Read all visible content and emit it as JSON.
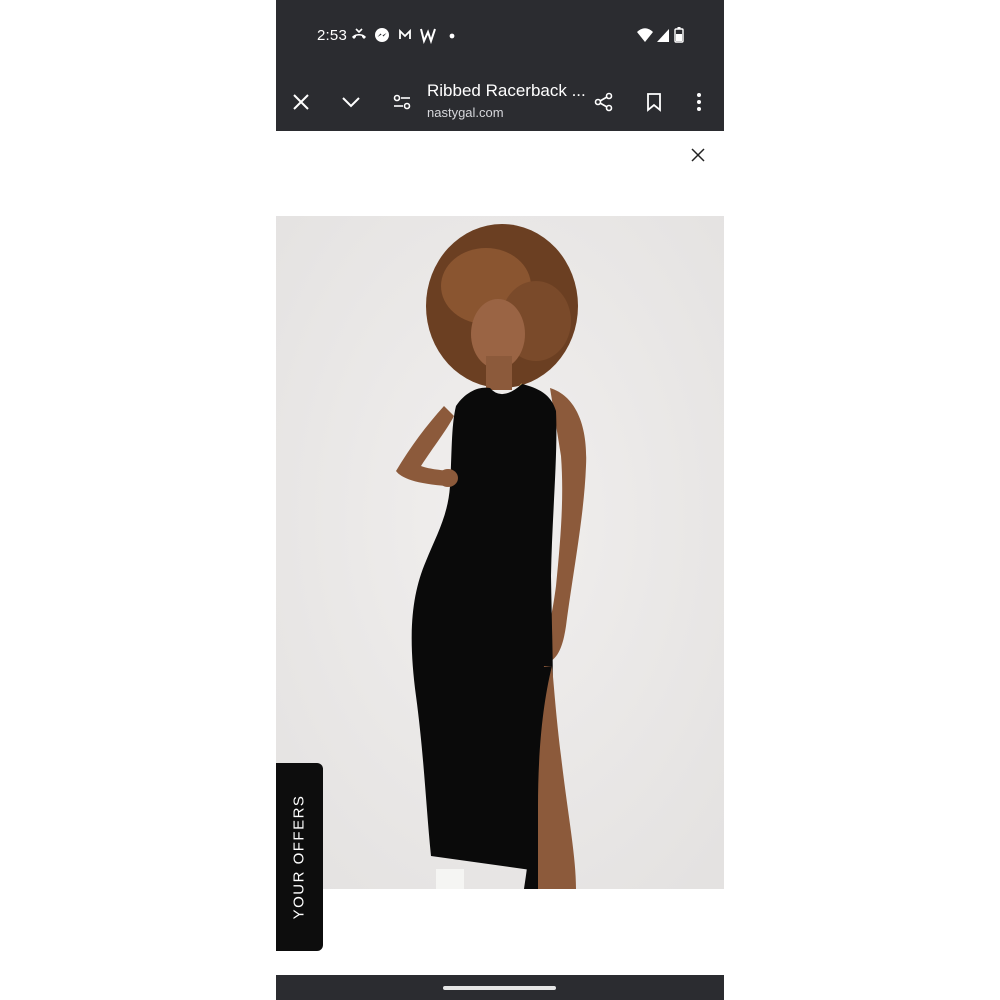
{
  "status_bar": {
    "time": "2:53",
    "icons": [
      "missed-call-icon",
      "messenger-icon",
      "gmail-icon",
      "w-app-icon",
      "dot-icon",
      "wifi-icon",
      "signal-icon",
      "battery-icon"
    ]
  },
  "toolbar": {
    "page_title": "Ribbed Racerback ...",
    "url": "nastygal.com",
    "icons": [
      "close-icon",
      "chevron-down-icon",
      "page-settings-icon",
      "share-icon",
      "bookmark-icon",
      "more-icon"
    ]
  },
  "page": {
    "offers_tab_label": "YOUR OFFERS"
  },
  "colors": {
    "chrome_bg": "#2b2c30",
    "image_bg": "#ebe9e8",
    "offers_tab_bg": "#0d0d0d"
  }
}
